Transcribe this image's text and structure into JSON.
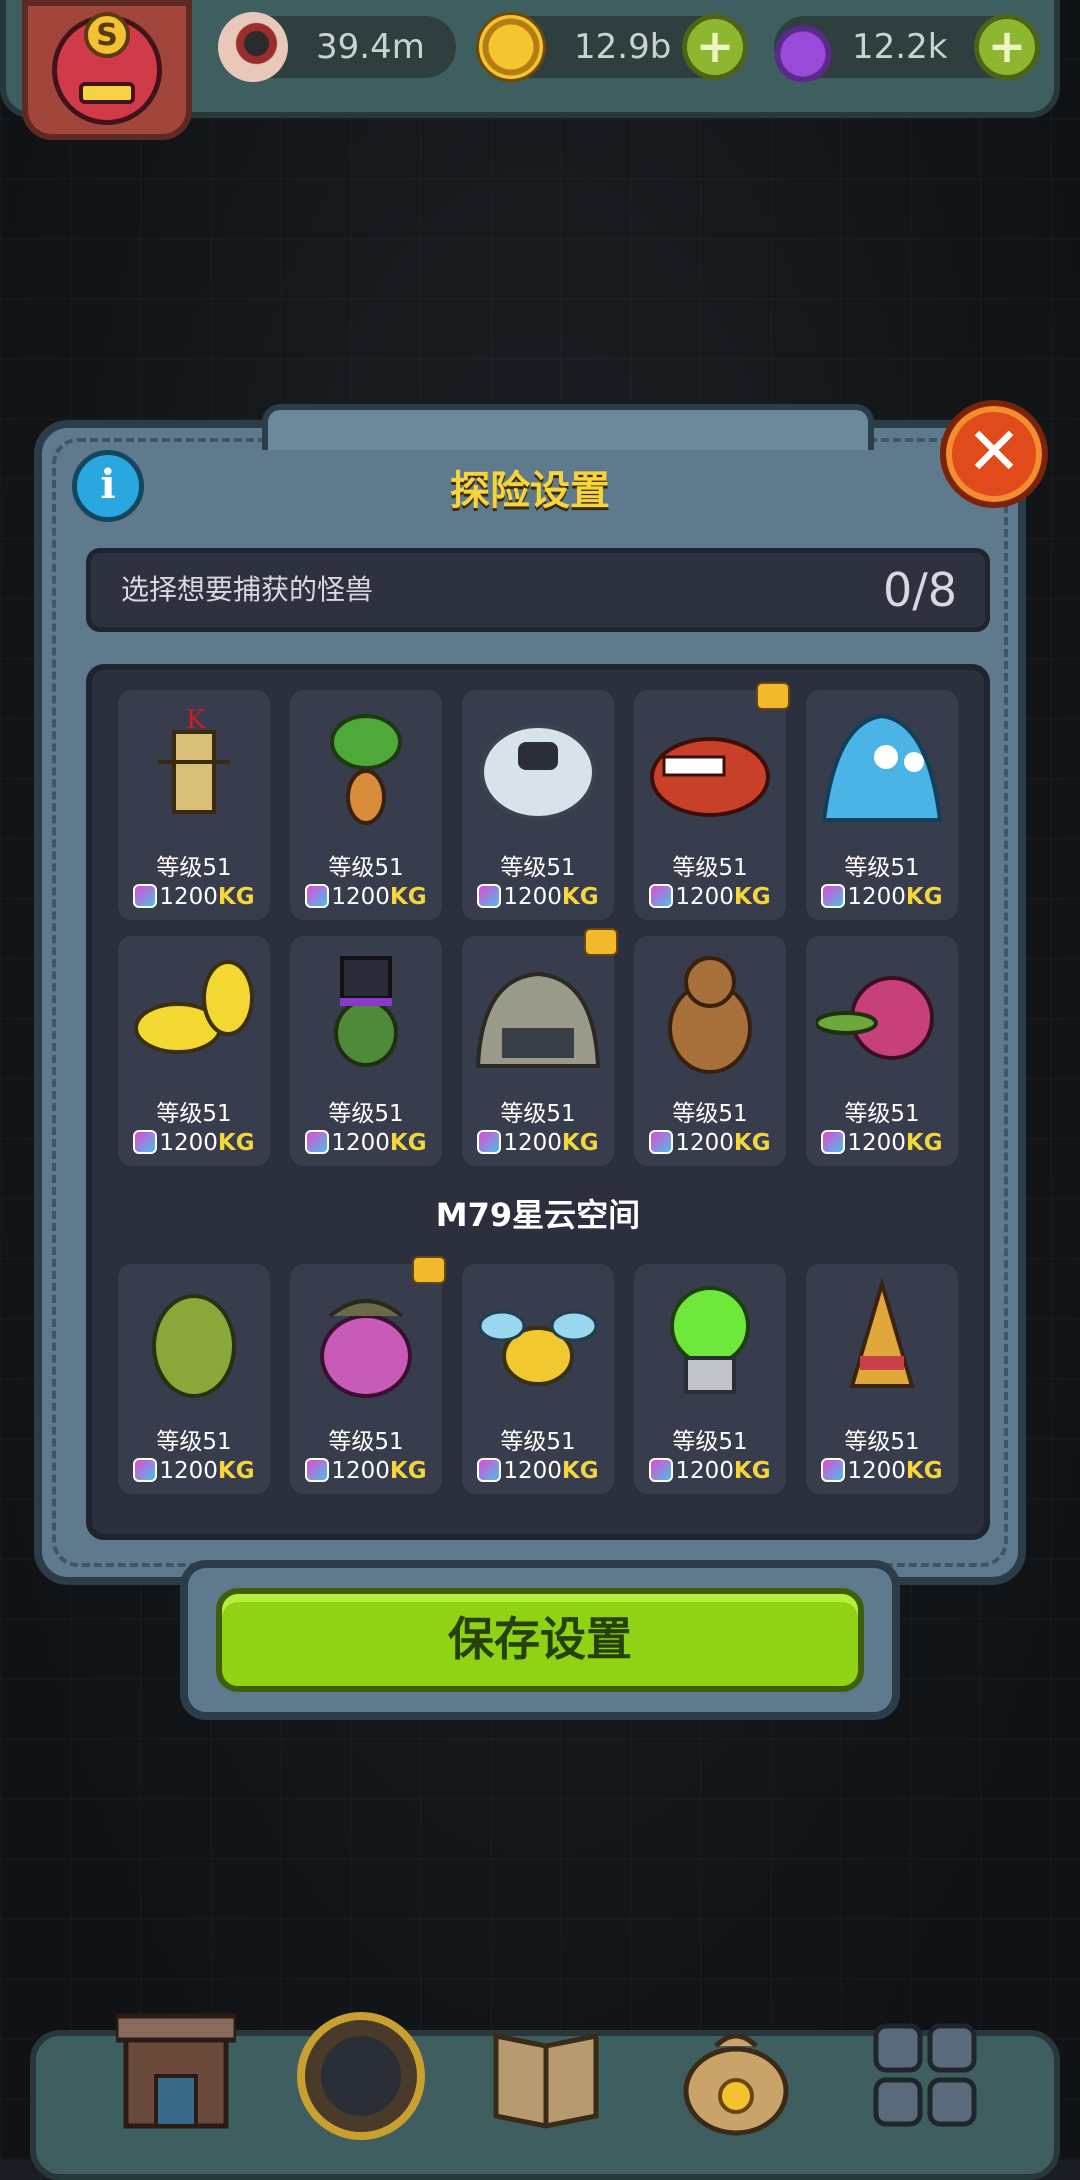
{
  "resources": {
    "eyes": "39.4m",
    "coins": "12.9b",
    "potions": "12.2k"
  },
  "modal": {
    "title": "探险设置",
    "prompt": "选择想要捕获的怪兽",
    "count": "0/8",
    "section_label": "M79星云空间",
    "save_label": "保存设置"
  },
  "monsters_group1": [
    {
      "level": "等级51",
      "weight": "1200",
      "unit": "KG",
      "name": "king-scarecrow-icon",
      "tag": false
    },
    {
      "level": "等级51",
      "weight": "1200",
      "unit": "KG",
      "name": "mandrake-icon",
      "tag": false
    },
    {
      "level": "等级51",
      "weight": "1200",
      "unit": "KG",
      "name": "yeti-icon",
      "tag": false
    },
    {
      "level": "等级51",
      "weight": "1200",
      "unit": "KG",
      "name": "red-dragon-icon",
      "tag": true
    },
    {
      "level": "等级51",
      "weight": "1200",
      "unit": "KG",
      "name": "blue-slime-icon",
      "tag": false
    },
    {
      "level": "等级51",
      "weight": "1200",
      "unit": "KG",
      "name": "yellow-lizard-icon",
      "tag": false
    },
    {
      "level": "等级51",
      "weight": "1200",
      "unit": "KG",
      "name": "top-hat-goblin-icon",
      "tag": false
    },
    {
      "level": "等级51",
      "weight": "1200",
      "unit": "KG",
      "name": "eye-mound-icon",
      "tag": true
    },
    {
      "level": "等级51",
      "weight": "1200",
      "unit": "KG",
      "name": "brown-bear-icon",
      "tag": false
    },
    {
      "level": "等级51",
      "weight": "1200",
      "unit": "KG",
      "name": "pink-croc-icon",
      "tag": false
    }
  ],
  "monsters_group2": [
    {
      "level": "等级51",
      "weight": "1200",
      "unit": "KG",
      "name": "green-pod-icon",
      "tag": false
    },
    {
      "level": "等级51",
      "weight": "1200",
      "unit": "KG",
      "name": "purple-beet-icon",
      "tag": true
    },
    {
      "level": "等级51",
      "weight": "1200",
      "unit": "KG",
      "name": "bee-icon",
      "tag": false
    },
    {
      "level": "等级51",
      "weight": "1200",
      "unit": "KG",
      "name": "dome-robot-icon",
      "tag": false
    },
    {
      "level": "等级51",
      "weight": "1200",
      "unit": "KG",
      "name": "bamboo-shoot-icon",
      "tag": false
    }
  ],
  "colors": {
    "title": "#f6d53a",
    "unit": "#f3d53e",
    "save": "#8fd314"
  }
}
